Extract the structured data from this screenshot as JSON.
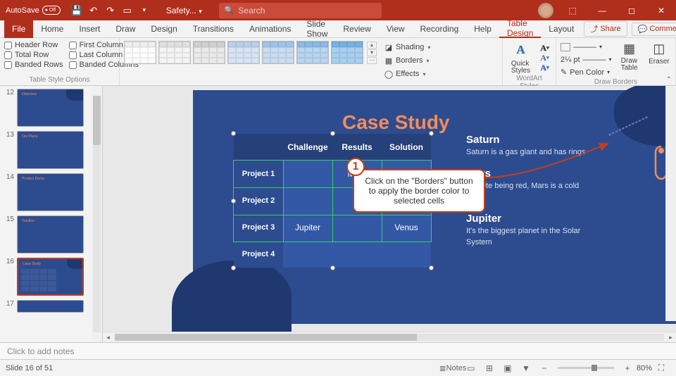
{
  "titlebar": {
    "autosave_label": "AutoSave",
    "autosave_state": "Off",
    "doc_name": "Safety...",
    "search_placeholder": "Search"
  },
  "tabs": {
    "file": "File",
    "home": "Home",
    "insert": "Insert",
    "draw": "Draw",
    "design": "Design",
    "transitions": "Transitions",
    "animations": "Animations",
    "slideshow": "Slide Show",
    "review": "Review",
    "view": "View",
    "recording": "Recording",
    "help": "Help",
    "table_design": "Table Design",
    "layout": "Layout",
    "share": "Share",
    "comments": "Comments"
  },
  "ribbon": {
    "tso": {
      "header_row": "Header Row",
      "first_column": "First Column",
      "total_row": "Total Row",
      "last_column": "Last Column",
      "banded_rows": "Banded Rows",
      "banded_columns": "Banded Columns",
      "group_label": "Table Style Options"
    },
    "styles": {
      "shading": "Shading",
      "borders": "Borders",
      "effects": "Effects"
    },
    "wordart": {
      "quick_styles": "Quick\nStyles",
      "group_label": "WordArt Styles"
    },
    "drawb": {
      "pen_weight": "2¼ pt",
      "pen_color": "Pen Color",
      "draw_table": "Draw\nTable",
      "eraser": "Eraser",
      "group_label": "Draw Borders"
    }
  },
  "callout": {
    "num": "1",
    "text": "Click on the \"Borders\" button to apply the border color to selected cells"
  },
  "thumbs": [
    "12",
    "13",
    "14",
    "15",
    "16",
    "17"
  ],
  "slide": {
    "title": "Case Study",
    "table": {
      "cols": [
        "",
        "Challenge",
        "Results",
        "Solution"
      ],
      "rows": [
        {
          "h": "Project 1",
          "c": [
            "",
            "Mars",
            ""
          ]
        },
        {
          "h": "Project 2",
          "c": [
            "",
            "",
            ""
          ]
        },
        {
          "h": "Project 3",
          "c": [
            "Jupiter",
            "",
            "Venus"
          ]
        },
        {
          "h": "Project 4",
          "c": [
            "",
            "",
            ""
          ]
        }
      ]
    },
    "side": [
      {
        "h": "Saturn",
        "p": "Saturn is a gas giant and has rings"
      },
      {
        "h": "Mars",
        "p": "Despite being red, Mars is a cold place"
      },
      {
        "h": "Jupiter",
        "p": "It's the biggest planet in the Solar System"
      }
    ]
  },
  "notes_placeholder": "Click to add notes",
  "status": {
    "slide_info": "Slide 16 of 51",
    "notes": "Notes",
    "zoom": "80%"
  }
}
